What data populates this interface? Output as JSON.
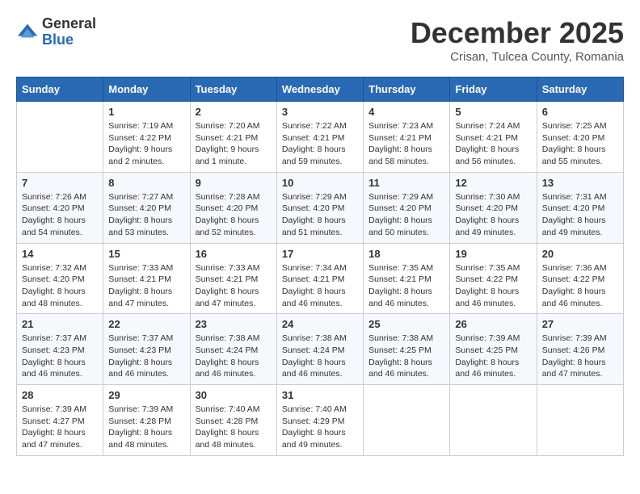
{
  "logo": {
    "general": "General",
    "blue": "Blue"
  },
  "title": {
    "month": "December 2025",
    "location": "Crisan, Tulcea County, Romania"
  },
  "days_of_week": [
    "Sunday",
    "Monday",
    "Tuesday",
    "Wednesday",
    "Thursday",
    "Friday",
    "Saturday"
  ],
  "weeks": [
    [
      {
        "day": "",
        "info": ""
      },
      {
        "day": "1",
        "info": "Sunrise: 7:19 AM\nSunset: 4:22 PM\nDaylight: 9 hours\nand 2 minutes."
      },
      {
        "day": "2",
        "info": "Sunrise: 7:20 AM\nSunset: 4:21 PM\nDaylight: 9 hours\nand 1 minute."
      },
      {
        "day": "3",
        "info": "Sunrise: 7:22 AM\nSunset: 4:21 PM\nDaylight: 8 hours\nand 59 minutes."
      },
      {
        "day": "4",
        "info": "Sunrise: 7:23 AM\nSunset: 4:21 PM\nDaylight: 8 hours\nand 58 minutes."
      },
      {
        "day": "5",
        "info": "Sunrise: 7:24 AM\nSunset: 4:21 PM\nDaylight: 8 hours\nand 56 minutes."
      },
      {
        "day": "6",
        "info": "Sunrise: 7:25 AM\nSunset: 4:20 PM\nDaylight: 8 hours\nand 55 minutes."
      }
    ],
    [
      {
        "day": "7",
        "info": "Sunrise: 7:26 AM\nSunset: 4:20 PM\nDaylight: 8 hours\nand 54 minutes."
      },
      {
        "day": "8",
        "info": "Sunrise: 7:27 AM\nSunset: 4:20 PM\nDaylight: 8 hours\nand 53 minutes."
      },
      {
        "day": "9",
        "info": "Sunrise: 7:28 AM\nSunset: 4:20 PM\nDaylight: 8 hours\nand 52 minutes."
      },
      {
        "day": "10",
        "info": "Sunrise: 7:29 AM\nSunset: 4:20 PM\nDaylight: 8 hours\nand 51 minutes."
      },
      {
        "day": "11",
        "info": "Sunrise: 7:29 AM\nSunset: 4:20 PM\nDaylight: 8 hours\nand 50 minutes."
      },
      {
        "day": "12",
        "info": "Sunrise: 7:30 AM\nSunset: 4:20 PM\nDaylight: 8 hours\nand 49 minutes."
      },
      {
        "day": "13",
        "info": "Sunrise: 7:31 AM\nSunset: 4:20 PM\nDaylight: 8 hours\nand 49 minutes."
      }
    ],
    [
      {
        "day": "14",
        "info": "Sunrise: 7:32 AM\nSunset: 4:20 PM\nDaylight: 8 hours\nand 48 minutes."
      },
      {
        "day": "15",
        "info": "Sunrise: 7:33 AM\nSunset: 4:21 PM\nDaylight: 8 hours\nand 47 minutes."
      },
      {
        "day": "16",
        "info": "Sunrise: 7:33 AM\nSunset: 4:21 PM\nDaylight: 8 hours\nand 47 minutes."
      },
      {
        "day": "17",
        "info": "Sunrise: 7:34 AM\nSunset: 4:21 PM\nDaylight: 8 hours\nand 46 minutes."
      },
      {
        "day": "18",
        "info": "Sunrise: 7:35 AM\nSunset: 4:21 PM\nDaylight: 8 hours\nand 46 minutes."
      },
      {
        "day": "19",
        "info": "Sunrise: 7:35 AM\nSunset: 4:22 PM\nDaylight: 8 hours\nand 46 minutes."
      },
      {
        "day": "20",
        "info": "Sunrise: 7:36 AM\nSunset: 4:22 PM\nDaylight: 8 hours\nand 46 minutes."
      }
    ],
    [
      {
        "day": "21",
        "info": "Sunrise: 7:37 AM\nSunset: 4:23 PM\nDaylight: 8 hours\nand 46 minutes."
      },
      {
        "day": "22",
        "info": "Sunrise: 7:37 AM\nSunset: 4:23 PM\nDaylight: 8 hours\nand 46 minutes."
      },
      {
        "day": "23",
        "info": "Sunrise: 7:38 AM\nSunset: 4:24 PM\nDaylight: 8 hours\nand 46 minutes."
      },
      {
        "day": "24",
        "info": "Sunrise: 7:38 AM\nSunset: 4:24 PM\nDaylight: 8 hours\nand 46 minutes."
      },
      {
        "day": "25",
        "info": "Sunrise: 7:38 AM\nSunset: 4:25 PM\nDaylight: 8 hours\nand 46 minutes."
      },
      {
        "day": "26",
        "info": "Sunrise: 7:39 AM\nSunset: 4:25 PM\nDaylight: 8 hours\nand 46 minutes."
      },
      {
        "day": "27",
        "info": "Sunrise: 7:39 AM\nSunset: 4:26 PM\nDaylight: 8 hours\nand 47 minutes."
      }
    ],
    [
      {
        "day": "28",
        "info": "Sunrise: 7:39 AM\nSunset: 4:27 PM\nDaylight: 8 hours\nand 47 minutes."
      },
      {
        "day": "29",
        "info": "Sunrise: 7:39 AM\nSunset: 4:28 PM\nDaylight: 8 hours\nand 48 minutes."
      },
      {
        "day": "30",
        "info": "Sunrise: 7:40 AM\nSunset: 4:28 PM\nDaylight: 8 hours\nand 48 minutes."
      },
      {
        "day": "31",
        "info": "Sunrise: 7:40 AM\nSunset: 4:29 PM\nDaylight: 8 hours\nand 49 minutes."
      },
      {
        "day": "",
        "info": ""
      },
      {
        "day": "",
        "info": ""
      },
      {
        "day": "",
        "info": ""
      }
    ]
  ]
}
